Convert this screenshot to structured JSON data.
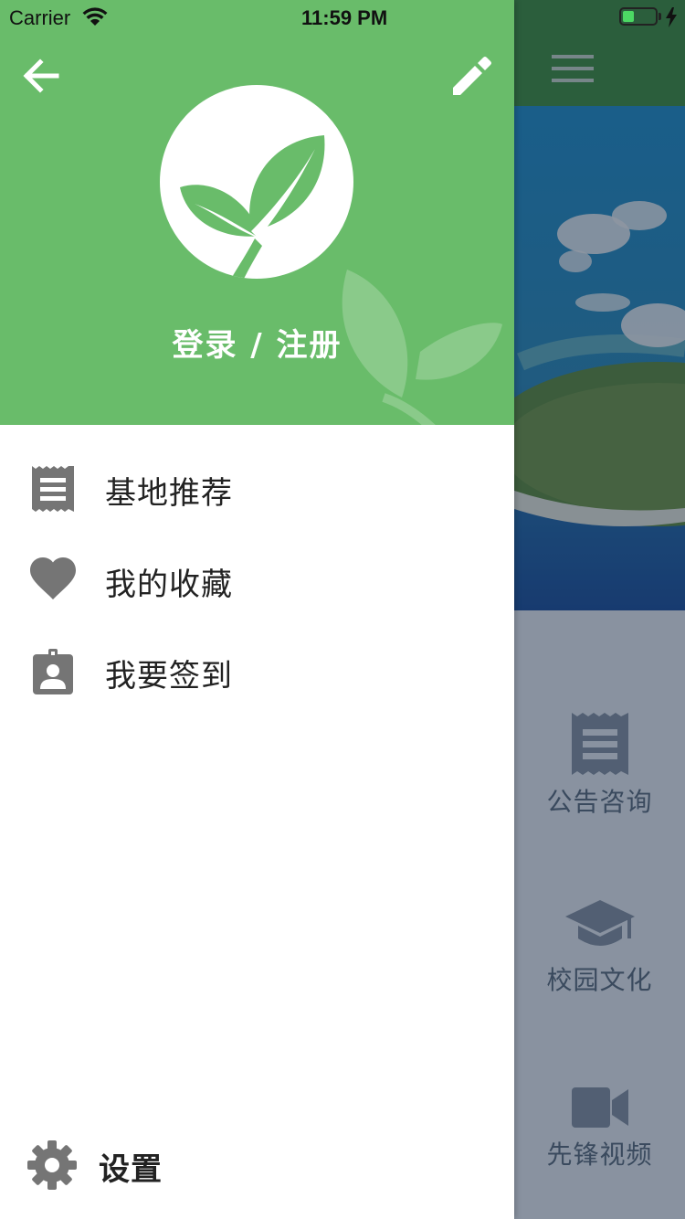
{
  "status_bar": {
    "carrier": "Carrier",
    "time": "11:59 PM",
    "battery_level": 0.35
  },
  "drawer": {
    "header": {
      "login_label": "登录 / 注册"
    },
    "menu": [
      {
        "label": "基地推荐",
        "icon": "receipt-icon"
      },
      {
        "label": "我的收藏",
        "icon": "heart-icon"
      },
      {
        "label": "我要签到",
        "icon": "checkin-badge-icon"
      }
    ],
    "settings_label": "设置"
  },
  "main": {
    "features": [
      {
        "label": "公告咨询",
        "icon": "receipt-icon"
      },
      {
        "label": "校园文化",
        "icon": "graduation-cap-icon"
      },
      {
        "label": "先锋视频",
        "icon": "video-camera-icon"
      }
    ]
  },
  "colors": {
    "drawer_header": "#69bc6a",
    "main_topbar": "#3e8f3d",
    "icon_gray": "#757575",
    "battery": "#4cd964"
  }
}
